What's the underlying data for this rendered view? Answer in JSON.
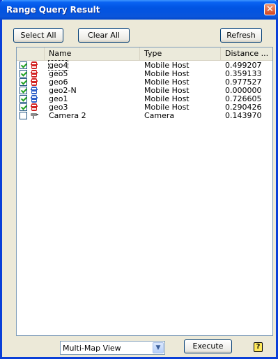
{
  "window": {
    "title": "Range Query Result"
  },
  "toolbar": {
    "select_all": "Select All",
    "clear_all": "Clear All",
    "refresh": "Refresh"
  },
  "columns": [
    "Name",
    "Type",
    "Distance ..."
  ],
  "rows": [
    {
      "checked": true,
      "icon": "car-icon-red",
      "name": "geo4",
      "type": "Mobile Host",
      "distance": "0.499207"
    },
    {
      "checked": true,
      "icon": "car-icon-red",
      "name": "geo5",
      "type": "Mobile Host",
      "distance": "0.359133"
    },
    {
      "checked": true,
      "icon": "car-icon-red",
      "name": "geo6",
      "type": "Mobile Host",
      "distance": "0.977527"
    },
    {
      "checked": true,
      "icon": "car-icon-blue",
      "name": "geo2-N",
      "type": "Mobile Host",
      "distance": "0.000000"
    },
    {
      "checked": true,
      "icon": "car-icon-blue",
      "name": "geo1",
      "type": "Mobile Host",
      "distance": "0.726605"
    },
    {
      "checked": true,
      "icon": "car-icon-red",
      "name": "geo3",
      "type": "Mobile Host",
      "distance": "0.290426"
    },
    {
      "checked": false,
      "icon": "camera-icon",
      "name": "Camera 2",
      "type": "Camera",
      "distance": "0.143970"
    }
  ],
  "footer": {
    "view_select": "Multi-Map View",
    "execute": "Execute",
    "help": "?"
  },
  "colors": {
    "title_bar": "#0054e3",
    "close": "#d4451e",
    "car_red": "#d22222",
    "car_blue": "#2c5ec8"
  }
}
